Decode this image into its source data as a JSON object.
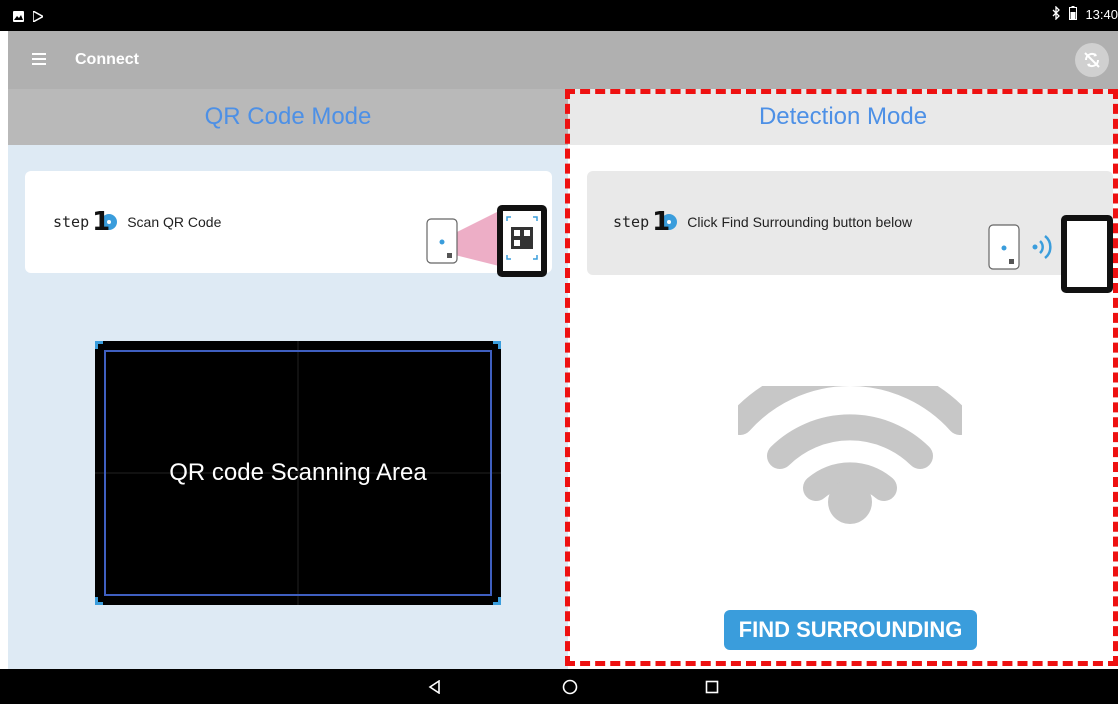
{
  "status_bar": {
    "time": "13:40",
    "icons": [
      "image-icon",
      "play-store-icon",
      "bluetooth-icon",
      "battery-icon"
    ]
  },
  "app_bar": {
    "title": "Connect",
    "icons": [
      "hamburger-menu-icon",
      "sync-off-icon"
    ]
  },
  "qr_mode": {
    "title": "QR Code Mode",
    "step_word": "step",
    "step_number": "1",
    "step_text": "Scan QR Code",
    "scan_area_label": "QR code Scanning Area"
  },
  "detection_mode": {
    "title": "Detection Mode",
    "step_word": "step",
    "step_number": "1",
    "step_text": "Click Find Surrounding button below",
    "find_button_label": "FIND SURROUNDING"
  },
  "nav_bar": {
    "icons": [
      "back-icon",
      "home-icon",
      "recents-icon"
    ]
  },
  "colors": {
    "accent": "#3a9ddc",
    "header_text": "#4d90e6",
    "highlight": "#ee1111"
  }
}
